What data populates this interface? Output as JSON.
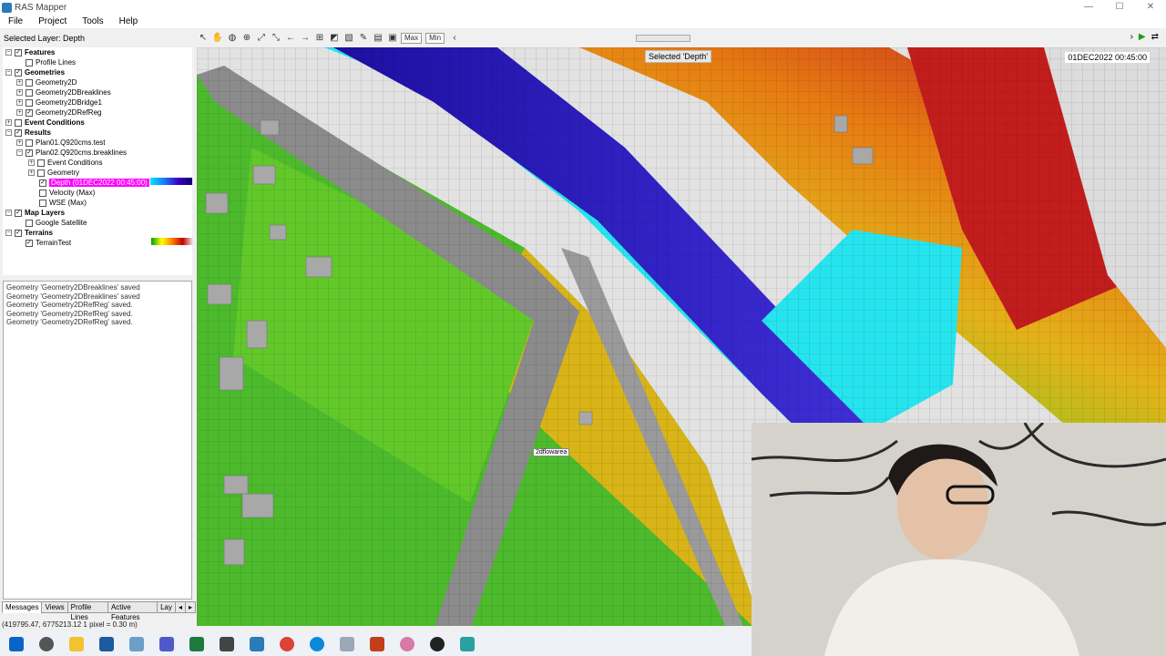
{
  "window": {
    "title": "RAS Mapper"
  },
  "menu": [
    "File",
    "Project",
    "Tools",
    "Help"
  ],
  "toolbar": {
    "selected_layer": "Selected Layer: Depth",
    "max_label": "Max",
    "min_label": "Min"
  },
  "tree": {
    "features": "Features",
    "profile_lines": "Profile Lines",
    "geometries": "Geometries",
    "geom_items": [
      "Geometry2D",
      "Geometry2DBreaklines",
      "Geometry2DBridge1",
      "Geometry2DRefReg"
    ],
    "event_conditions": "Event Conditions",
    "results": "Results",
    "plan1": "Plan01.Q920cms.test",
    "plan2": "Plan02.Q920cms.breaklines",
    "plan2_event": "Event Conditions",
    "plan2_geometry": "Geometry",
    "depth": "Depth (01DEC2022 00:45:00)",
    "velocity": "Velocity (Max)",
    "wse": "WSE (Max)",
    "map_layers": "Map Layers",
    "google": "Google Satellite",
    "terrains": "Terrains",
    "terrain_test": "TerrainTest"
  },
  "messages": [
    "Geometry 'Geometry2DBreaklines' saved",
    "Geometry 'Geometry2DBreaklines' saved",
    "Geometry 'Geometry2DRefReg' saved.",
    "Geometry 'Geometry2DRefReg' saved.",
    "Geometry 'Geometry2DRefReg' saved."
  ],
  "tabs": [
    "Messages",
    "Views",
    "Profile Lines",
    "Active Features",
    "Lay"
  ],
  "status": {
    "coords": "(419795.47, 6775213.12  1 pixel = 0.30 m)"
  },
  "map": {
    "selected_tag": "Selected 'Depth'",
    "timestamp": "01DEC2022 00:45:00",
    "flow_area_label": "2dflowarea"
  },
  "colors": {
    "depth_deep": "#2a1fb8",
    "depth_shallow": "#22e0f0",
    "terrain_low": "#2db82d",
    "terrain_high": "#c81e1e",
    "highlight": "#ff00ff"
  }
}
